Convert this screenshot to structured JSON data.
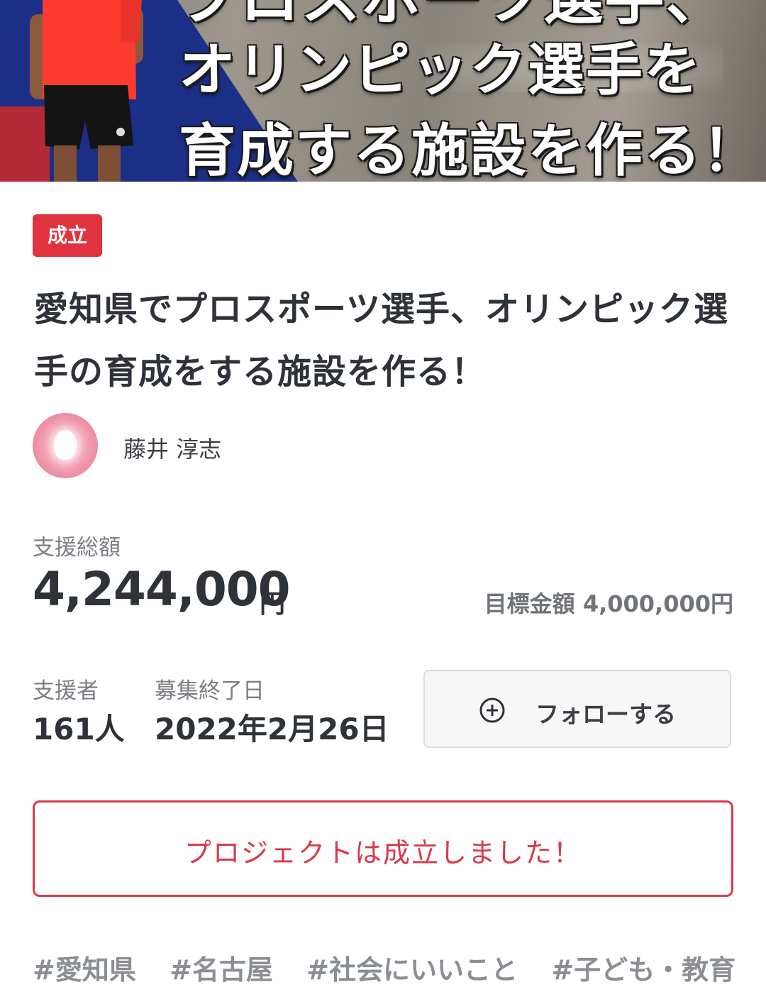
{
  "hero": {
    "line0": "プロスポーツ選手、",
    "line1": "オリンピック選手を",
    "line2": "育成する施設を作る！"
  },
  "project": {
    "status": "成立",
    "title": "愛知県でプロスポーツ選手、オリンピック選手の育成をする施設を作る！",
    "owner": "藤井 淳志"
  },
  "stats": {
    "total_label": "支援総額",
    "total_value": "4,244,000",
    "total_unit": "円",
    "goal_label": "目標金額",
    "goal_value": "4,000,000円",
    "supporters_label": "支援者",
    "supporters_value": "161人",
    "end_label": "募集終了日",
    "end_value": "2022年2月26日"
  },
  "actions": {
    "follow_label": "フォローする",
    "success_message": "プロジェクトは成立しました！"
  },
  "tags": [
    "#愛知県",
    "#名古屋",
    "#社会にいいこと",
    "#子ども・教育"
  ],
  "colors": {
    "accent": "#e0323f",
    "text": "#2d3338",
    "muted": "#7a7f84"
  },
  "icons": {
    "follow": "plus-circle-icon",
    "avatar": "user-avatar"
  }
}
